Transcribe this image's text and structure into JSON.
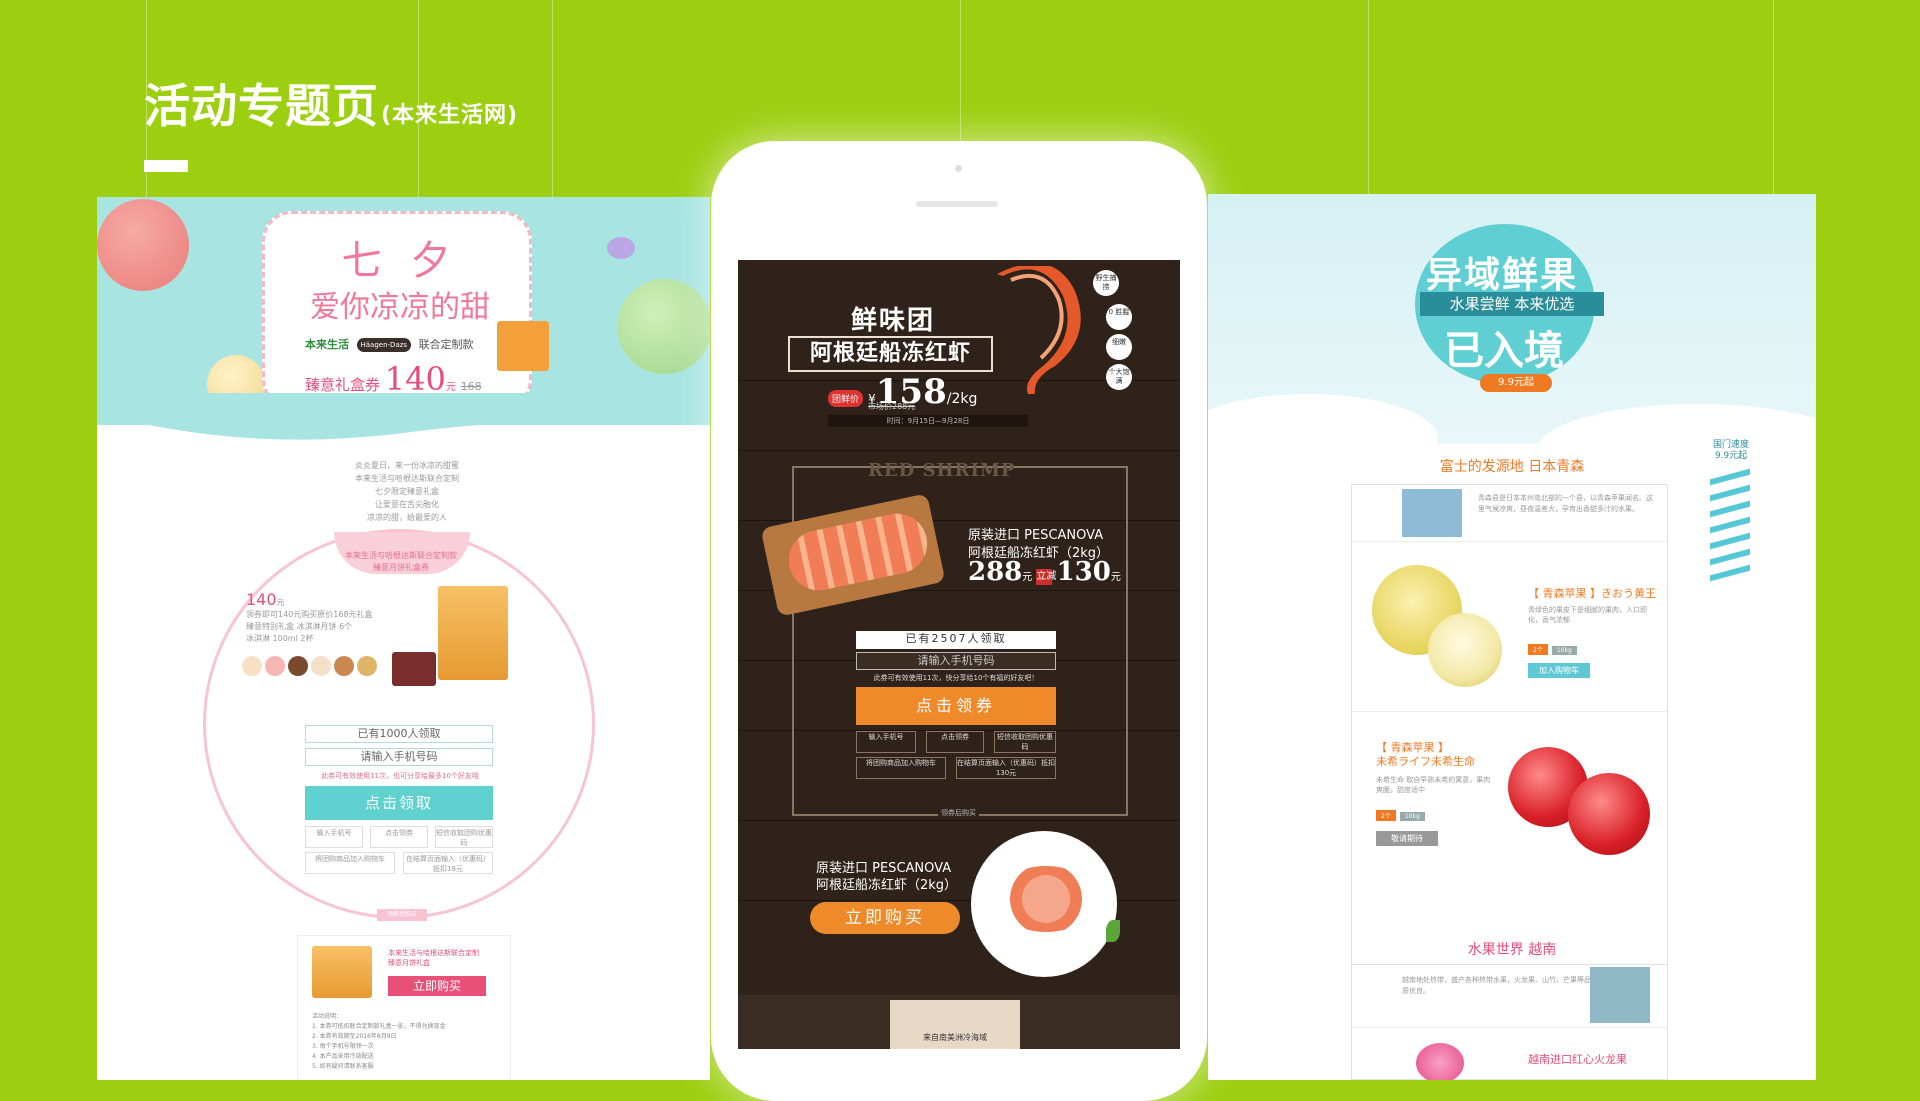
{
  "header": {
    "title": "活动专题页",
    "subtitle": "(本来生活网)"
  },
  "left_panel": {
    "hero": {
      "title_line1": "七 夕",
      "title_line2": "爱你凉凉的甜",
      "brand": "本来生活",
      "partner": "Häagen-Dazs",
      "collab": "联合定制款",
      "coupon_label": "臻意礼盒券",
      "coupon_value": "140",
      "coupon_unit": "元",
      "coupon_original": "168"
    },
    "desc": "炎炎夏日，来一份冰凉的甜蜜\n本来生活与哈根达斯联合定制\n七夕限定臻意礼盒\n让爱意在舌尖融化\n凉凉的甜，给最爱的人",
    "circle": {
      "heading": "本来生活与哈根达斯联合定制款\n臻意月饼礼盒券",
      "offer_price": "140",
      "offer_unit": "元",
      "offer_text": "领券即可140元购买原价168元礼盒\n臻意特别礼盒 冰淇淋月饼 6个\n冰淇淋 100ml 2杯"
    },
    "form": {
      "count_text": "已有1000人领取",
      "phone_placeholder": "请输入手机号码",
      "note": "此券可有效使用11次，也可分享给最多10个好友哦",
      "button": "点击领取",
      "steps": [
        "输入手机号",
        "点击领券",
        "短信收取团购优惠码",
        "将团购商品加入购物车",
        "在结算页面输入（优惠码）抵扣18元"
      ]
    },
    "bottom": {
      "tab": "领券后购买",
      "card_text": "本来生活与哈根达斯联合定制\n臻意月饼礼盒",
      "buy_button": "立即购买",
      "rules": "活动说明：\n1. 本券可抵扣联合定制款礼盒一张，不得兑换现金\n2. 本券有效期至2016年8月9日\n3. 每个手机号限领一次\n4. 本产品采用冷链配送\n5. 如有疑问请联系客服"
    }
  },
  "phone": {
    "banner": "鲜味团",
    "title": "阿根廷船冻红虾",
    "price_tag": "团鲜价",
    "price": "158",
    "price_unit": "/2kg",
    "market_price": "市场价288元",
    "period": "时间：9月15日—9月28日",
    "stickers": [
      "野生捕捞",
      "0 胜腥",
      "细嫩",
      "个大饱满"
    ],
    "watermark": "RED SHRIMP",
    "product_line1": "原装进口  PESCANOVA",
    "product_line2": "阿根廷船冻红虾（2kg）",
    "old_price": "288",
    "minus_label": "立减",
    "new_price": "130",
    "unit": "元",
    "count_text": "已有2507人领取",
    "phone_placeholder": "请输入手机号码",
    "note": "此券可有效使用11次，快分享给10个有福的好友吧！",
    "button": "点击领券",
    "steps": [
      "输入手机号",
      "点击领券",
      "短信收取团购优惠码",
      "将团购商品加入购物车",
      "在结算页面输入（优惠码）抵扣130元"
    ],
    "footnote": "领券后购买",
    "buy_line1": "原装进口  PESCANOVA",
    "buy_line2": "阿根廷船冻红虾（2kg）",
    "buy_button": "立即购买",
    "bottom_caption": "来自南美洲冷海域"
  },
  "right_panel": {
    "hero": {
      "title1": "异域鲜果",
      "ribbon": "水果尝鲜 本来优选",
      "title2": "已入境",
      "price": "9.9元起"
    },
    "side_tag": "国门速度 9.9元起",
    "section1": {
      "heading": "富士的发源地 日本青森",
      "intro": "青森县是日本本州岛北部的一个县，以青森苹果闻名。这里气候凉爽，昼夜温差大，孕育出香甜多汁的水果。",
      "item1": {
        "title": "【 青森苹果 】きおう黄王",
        "desc": "青绿色的果皮下是细腻的果肉，入口即化，香气浓郁",
        "tags": [
          "2个",
          "10kg"
        ],
        "button": "加入购物车"
      },
      "item2": {
        "title": "【 青森苹果 】\n未希ライフ未希生命",
        "desc": "未希生命 取自早熟未希的寓意，果肉爽脆，甜度适中",
        "tags": [
          "2个",
          "10kg"
        ],
        "button": "敬请期待"
      }
    },
    "section2": {
      "heading": "水果世界 越南",
      "intro": "越南地处热带，盛产各种热带水果，火龙果、山竹、芒果等品质优良。",
      "item_title": "越南进口红心火龙果"
    }
  },
  "colors": {
    "background": "#9ccf10",
    "teal": "#5fd1cf",
    "pink": "#e95079",
    "orange": "#ee8a2a",
    "dark_wood": "#2f221a"
  }
}
